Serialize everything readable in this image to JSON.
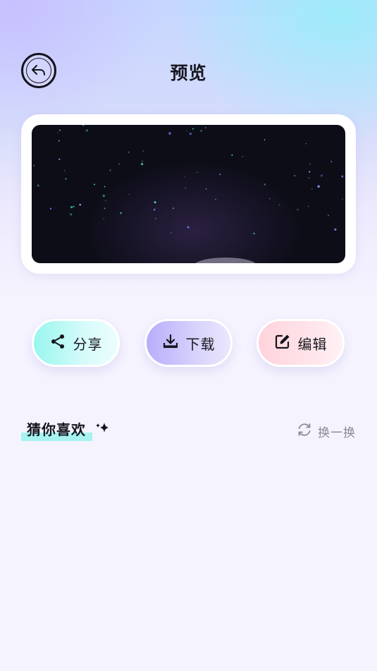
{
  "header": {
    "title": "预览",
    "back_icon": "back-arrow-icon"
  },
  "preview": {
    "image_description_icon": "starry-night-image"
  },
  "actions": [
    {
      "label": "分享",
      "icon": "share-icon",
      "color": "#98f6ee"
    },
    {
      "label": "下载",
      "icon": "download-icon",
      "color": "#b7aefb"
    },
    {
      "label": "编辑",
      "icon": "edit-icon",
      "color": "#ffd3dc"
    }
  ],
  "recommend": {
    "title": "猜你喜欢",
    "refresh_label": "换一换",
    "refresh_icon": "refresh-icon",
    "highlight_color": "#a6f3f0"
  }
}
